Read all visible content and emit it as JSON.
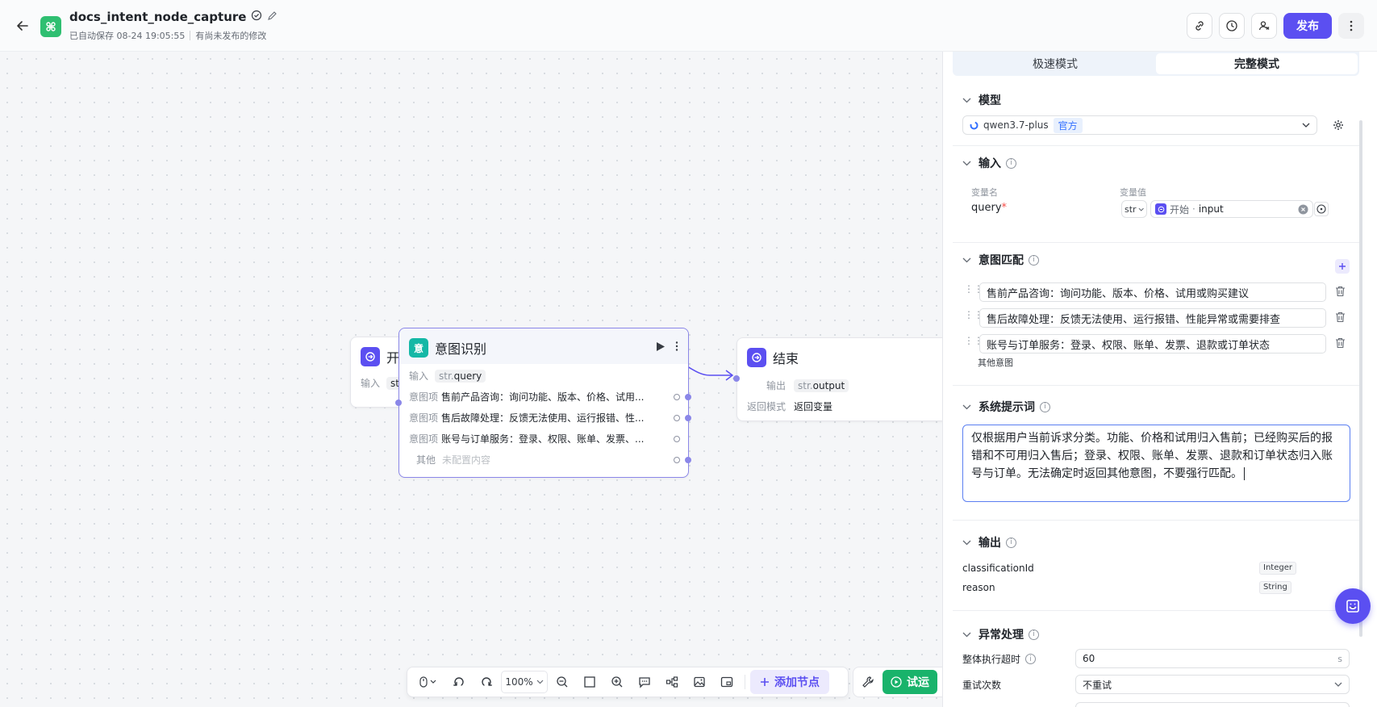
{
  "header": {
    "title": "docs_intent_node_capture",
    "autosave": "已自动保存 08-24 19:05:55",
    "unpublished": "有尚未发布的修改",
    "publish_label": "发布"
  },
  "canvas": {
    "start_node": {
      "title": "开",
      "input_label": "输入",
      "input_tag": "str"
    },
    "intent_node": {
      "icon_text": "意",
      "title": "意图识别",
      "input_label": "输入",
      "input_tag_prefix": "str.",
      "input_tag_name": "query",
      "items": [
        {
          "label": "意图项",
          "text": "售前产品咨询：询问功能、版本、价格、试用..."
        },
        {
          "label": "意图项",
          "text": "售后故障处理：反馈无法使用、运行报错、性..."
        },
        {
          "label": "意图项",
          "text": "账号与订单服务：登录、权限、账单、发票、..."
        },
        {
          "label": "其他",
          "text": "未配置内容"
        }
      ]
    },
    "end_node": {
      "title": "结束",
      "output_label": "输出",
      "output_tag_prefix": "str.",
      "output_tag_name": "output",
      "return_label": "返回模式",
      "return_value": "返回变量"
    }
  },
  "toolbar": {
    "zoom": "100%",
    "add_node_label": "添加节点",
    "trial_label": "试运"
  },
  "panel": {
    "tabs": [
      "极速模式",
      "完整模式"
    ],
    "active_tab": "完整模式",
    "model": {
      "title": "模型",
      "name": "qwen3.7-plus",
      "tag": "官方"
    },
    "input": {
      "title": "输入",
      "var_name_header": "变量名",
      "var_value_header": "变量值",
      "var_name": "query",
      "required_mark": "*",
      "type": "str",
      "source_node": "开始",
      "source_dot": "·",
      "source_var": "input"
    },
    "intent_match": {
      "title": "意图匹配",
      "items": [
        "售前产品咨询：询问功能、版本、价格、试用或购买建议",
        "售后故障处理：反馈无法使用、运行报错、性能异常或需要排查",
        "账号与订单服务：登录、权限、账单、发票、退款或订单状态"
      ],
      "other_label": "其他意图"
    },
    "system_prompt": {
      "title": "系统提示词",
      "text": "仅根据用户当前诉求分类。功能、价格和试用归入售前；已经购买后的报错和不可用归入售后；登录、权限、账单、发票、退款和订单状态归入账号与订单。无法确定时返回其他意图，不要强行匹配。"
    },
    "output": {
      "title": "输出",
      "fields": [
        {
          "name": "classificationId",
          "type": "Integer"
        },
        {
          "name": "reason",
          "type": "String"
        }
      ]
    },
    "exception": {
      "title": "异常处理",
      "timeout_label": "整体执行超时",
      "timeout_value": "60",
      "timeout_unit": "s",
      "retry_label": "重试次数",
      "retry_value": "不重试"
    }
  },
  "colors": {
    "accent": "#5b4ff1",
    "intent_icon": "#14b8a6",
    "app_icon": "#2fbf71",
    "trial": "#19b36b"
  }
}
